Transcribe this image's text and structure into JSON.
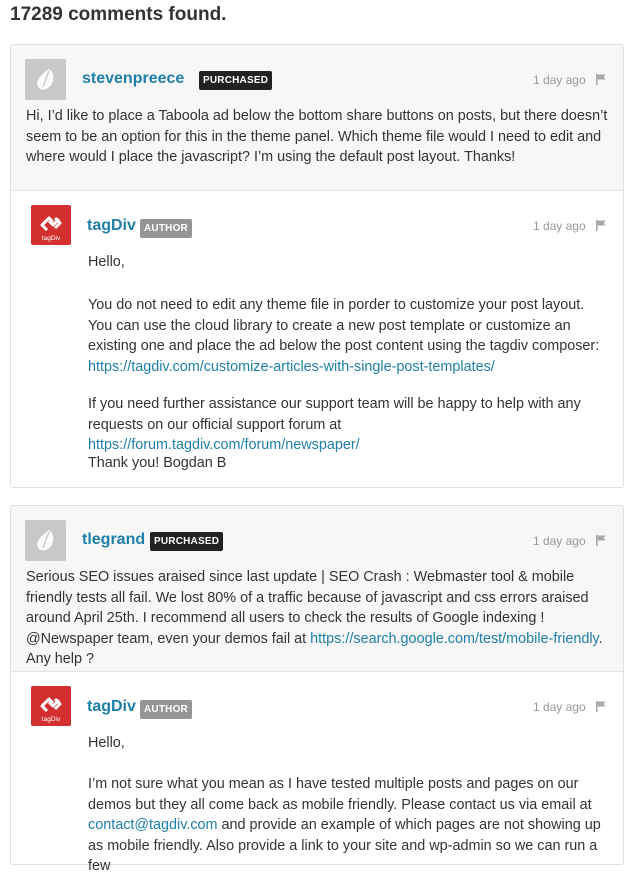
{
  "heading": "17289 comments found.",
  "threads": [
    {
      "comment": {
        "username": "stevenpreece",
        "badge": "PURCHASED",
        "time": "1 day ago",
        "text": "Hi, I’d like to place a Taboola ad below the bottom share buttons on posts, but there doesn’t seem to be an option for this in the theme panel. Which theme file would I need to edit and where would I place the javascript? I’m using the default post layout. Thanks!"
      },
      "reply": {
        "username": "tagDiv",
        "badge": "AUTHOR",
        "time": "1 day ago",
        "avatar_text": "tagDiv",
        "p1": "Hello,",
        "p2": "You do not need to edit any theme file in porder to customize your post layout. You can use the cloud library to create a new post template or customize an existing one and place the ad below the post content using the tagdiv composer: ",
        "p2_link": "https://tagdiv.com/customize-articles-with-single-post-templates/",
        "p3": "If you need further assistance our support team will be happy to help with any requests on our official support forum at ",
        "p3_link": "https://forum.tagdiv.com/forum/newspaper/",
        "p4": "Thank you! Bogdan B"
      }
    },
    {
      "comment": {
        "username": "tlegrand",
        "badge": "PURCHASED",
        "time": "1 day ago",
        "text": "Serious SEO issues araised since last update | SEO Crash : Webmaster tool & mobile friendly tests all fail. We lost 80% of a traffic because of javascript and css errors araised around April 25th. I recommend all users to check the results of Google indexing ! @Newspaper team, even your demos fail at ",
        "link": "https://search.google.com/test/mobile-friendly",
        "text_after": ". Any help ?"
      },
      "reply": {
        "username": "tagDiv",
        "badge": "AUTHOR",
        "time": "1 day ago",
        "avatar_text": "tagDiv",
        "p1": "Hello,",
        "p2": "I’m not sure what you mean as I have tested multiple posts and pages on our demos but they all come back as mobile friendly. Please contact us via email at ",
        "p2_link": "contact@tagdiv.com",
        "p2_after": " and provide an example of which pages are not showing up as mobile friendly. Also provide a link to your site and wp-admin so we can run a few"
      }
    }
  ],
  "colors": {
    "link": "#1e7fa8",
    "badge_purchased": "#222222",
    "badge_author": "#959595",
    "tagdiv_brand": "#d32f2f"
  },
  "icons": [
    "flag-icon",
    "envato-leaf-icon",
    "tagdiv-logo-icon"
  ]
}
